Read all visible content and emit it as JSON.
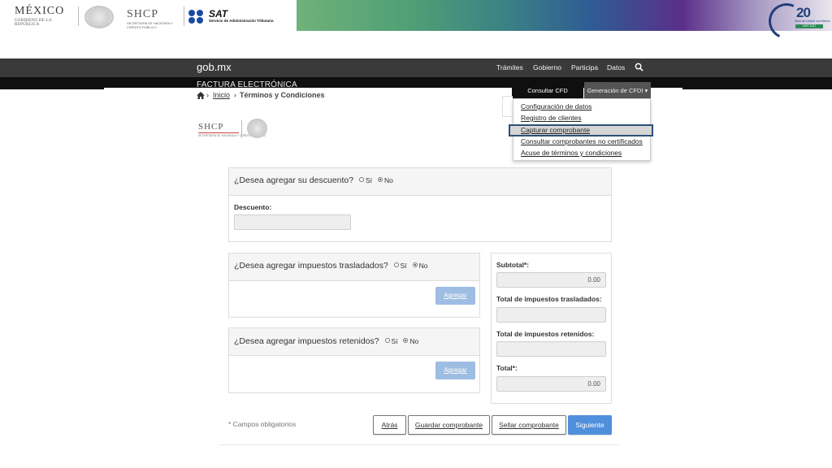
{
  "banner": {
    "mexico_logo_text": "MÉXICO",
    "mexico_logo_sub": "GOBIERNO DE LA REPÚBLICA",
    "shcp_logo_text": "SHCP",
    "shcp_logo_sub": "SECRETARÍA DE HACIENDA Y CRÉDITO PÚBLICO",
    "sat_logo_text": "SAT",
    "sat_logo_sub": "Servicio de Administración Tributaria",
    "anniversary_number": "20",
    "anniversary_text": "Años de cumplir con México",
    "anniversary_years": "1997-2017"
  },
  "navbar": {
    "brand": "gob.mx",
    "items": [
      "Trámites",
      "Gobierno",
      "Participa",
      "Datos"
    ],
    "search_icon": "search-icon"
  },
  "subheader": {
    "title": "FACTURA ELECTRÓNICA",
    "tabs": [
      "Consultar CFD",
      "Generación de CFDI ▾"
    ]
  },
  "dropdown": {
    "items": [
      "Configuración de datos",
      "Registro de clientes",
      "Capturar comprobante",
      "Consultar comprobantes no certificados",
      "Acuse de términos y condiciones"
    ],
    "selected_index": 2
  },
  "breadcrumb": {
    "home_icon": "home-icon",
    "link": "Inicio",
    "current": "Términos y Condiciones"
  },
  "descuento_panel": {
    "question": "¿Desea agregar su descuento?",
    "option_yes": "Sí",
    "option_no": "No",
    "selected": "No",
    "field_label": "Descuento:",
    "field_value": ""
  },
  "traslados_panel": {
    "question": "¿Desea agregar impuestos trasladados?",
    "option_yes": "Sí",
    "option_no": "No",
    "selected": "No",
    "button": "Agregar"
  },
  "retenidos_panel": {
    "question": "¿Desea agregar impuestos retenidos?",
    "option_yes": "Sí",
    "option_no": "No",
    "selected": "No",
    "button": "Agregar"
  },
  "totals": {
    "subtotal_label": "Subtotal*:",
    "subtotal_value": "0.00",
    "traslados_label": "Total de impuestos trasladados:",
    "traslados_value": "",
    "retenidos_label": "Total de impuestos retenidos:",
    "retenidos_value": "",
    "total_label": "Total*:",
    "total_value": "0.00"
  },
  "footer": {
    "required_note": "* Campos obligatorios",
    "buttons": [
      "Atrás",
      "Guardar comprobante",
      "Sellar comprobante",
      "Siguiente"
    ]
  },
  "colors": {
    "navbar_bg": "#3a3a3a",
    "subheader_bg": "#0f0f0f",
    "primary_button": "#4f8fdc",
    "disabled_button": "#9dbde3",
    "dropdown_selected_border": "#2e4f7a"
  }
}
